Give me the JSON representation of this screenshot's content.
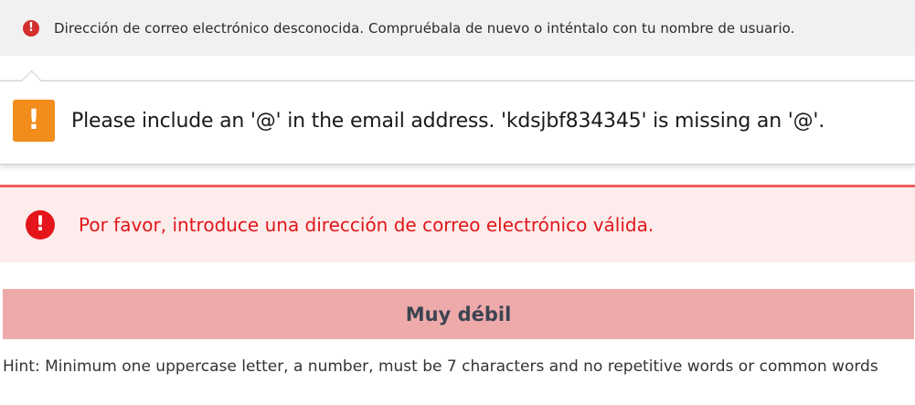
{
  "top_notice": {
    "icon": "alert-circle-icon",
    "text": "Dirección de correo electrónico desconocida. Compruébala de nuevo o inténtalo con tu nombre de usuario.",
    "color": "#d32f2f"
  },
  "validation_tooltip": {
    "icon": "warning-icon",
    "icon_glyph": "!",
    "message": "Please include an '@' in the email address. 'kdsjbf834345' is missing an '@'.",
    "icon_color": "#f28c1b"
  },
  "alert": {
    "icon": "alert-circle-icon",
    "icon_glyph": "!",
    "text": "Por favor, introduce una dirección de correo electrónico válida.",
    "color": "#e0161a",
    "background": "#fdecec"
  },
  "password_strength": {
    "label": "Muy débil",
    "color": "#eeaaaa"
  },
  "hint": {
    "text": "Hint: Minimum one uppercase letter, a number, must be 7 characters and no repetitive words or common words"
  }
}
